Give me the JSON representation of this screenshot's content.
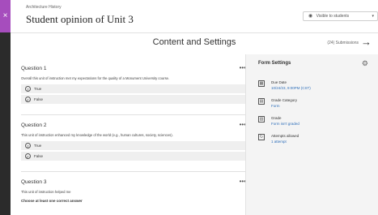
{
  "header": {
    "breadcrumb": "Architecture History",
    "title": "Student opinion of Unit 3",
    "close_icon": "×",
    "visibility_label": "Visible to students",
    "visibility_caret": "▾"
  },
  "subheader": {
    "title": "Content and Settings",
    "submissions": "(24) Submissions",
    "next_icon": "→"
  },
  "questions": [
    {
      "title": "Question 1",
      "menu": "•••",
      "text": "Overall this unit of instruction met my expectations for the quality of a Monument University course.",
      "options": [
        {
          "badge": "T",
          "label": "True"
        },
        {
          "badge": "F",
          "label": "False"
        }
      ]
    },
    {
      "title": "Question 2",
      "menu": "•••",
      "text": "This unit of instruction enhanced my knowledge of the world (e.g., human cultures, society, sciences).",
      "options": [
        {
          "badge": "T",
          "label": "True"
        },
        {
          "badge": "F",
          "label": "False"
        }
      ]
    },
    {
      "title": "Question 3",
      "menu": "•••",
      "text": "This unit of instruction helped me",
      "instruction": "Choose at least one correct answer"
    }
  ],
  "form_settings": {
    "title": "Form Settings",
    "gear_icon": "⚙",
    "items": [
      {
        "icon": "calendar-icon",
        "glyph": "▦",
        "label": "Due Date",
        "value": "10/24/23, 9:00PM (CST)"
      },
      {
        "icon": "grade-category-icon",
        "glyph": "▤",
        "label": "Grade Category",
        "value": "Form"
      },
      {
        "icon": "grade-icon",
        "glyph": "▥",
        "label": "Grade",
        "value": "Form isn't graded"
      },
      {
        "icon": "attempts-icon",
        "glyph": "↻",
        "label": "Attempts allowed",
        "value": "1 attempt"
      }
    ]
  }
}
